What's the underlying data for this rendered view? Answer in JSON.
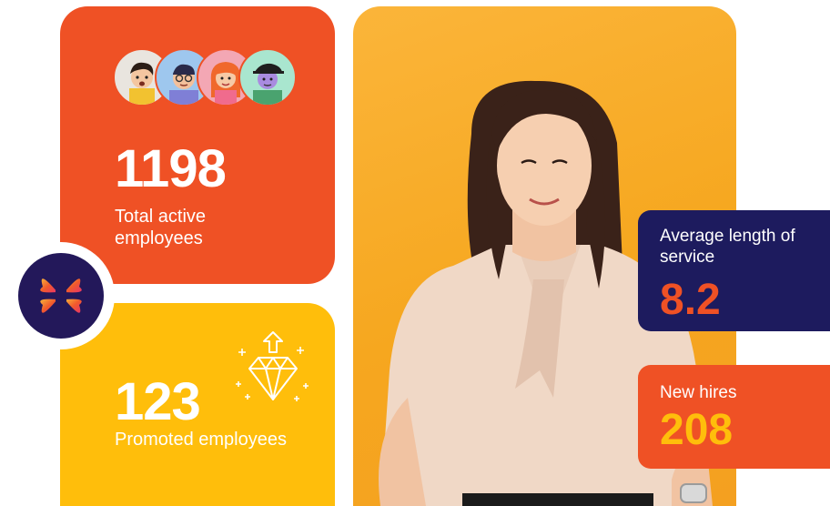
{
  "active": {
    "number": "1198",
    "caption": "Total active employees"
  },
  "promoted": {
    "number": "123",
    "caption": "Promoted employees"
  },
  "service": {
    "label": "Average length of service",
    "value": "8.2"
  },
  "hires": {
    "label": "New hires",
    "value": "208"
  },
  "icons": {
    "logo": "brand-logo-icon",
    "diamond": "diamond-arrow-icon",
    "avatars": [
      "avatar-1",
      "avatar-2",
      "avatar-3",
      "avatar-4"
    ]
  },
  "colors": {
    "orange": "#ef5125",
    "yellow": "#ffbe0b",
    "navy": "#1d1b5e",
    "photo_bg": "#f6a71f"
  }
}
